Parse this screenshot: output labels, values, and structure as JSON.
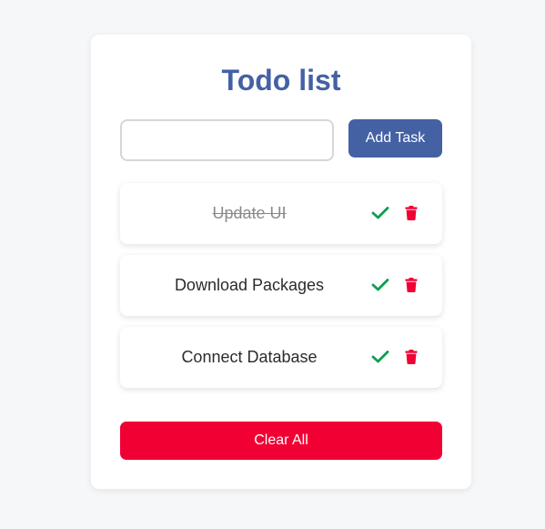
{
  "app": {
    "title": "Todo list"
  },
  "input": {
    "value": "",
    "placeholder": ""
  },
  "add_button": {
    "label": "Add Task"
  },
  "tasks": [
    {
      "text": "Update UI",
      "completed": true
    },
    {
      "text": "Download Packages",
      "completed": false
    },
    {
      "text": "Connect Database",
      "completed": false
    }
  ],
  "clear_button": {
    "label": "Clear All"
  },
  "icons": {
    "complete": "check-icon",
    "delete": "trash-icon"
  },
  "colors": {
    "background": "#f6f7f9",
    "primary": "#4461a4",
    "danger": "#f10034",
    "check": "#0aa04f"
  }
}
